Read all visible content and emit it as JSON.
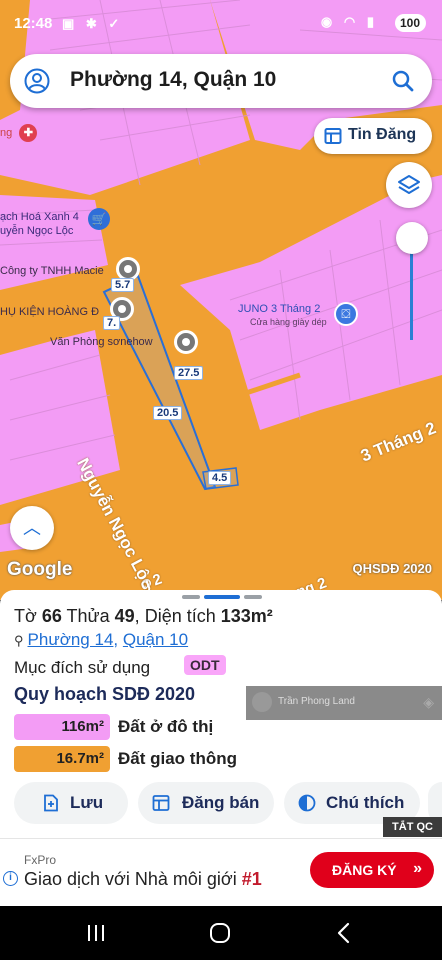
{
  "status_bar": {
    "time": "12:48",
    "left_icons": "▣ ✱ ✓",
    "right_icons": "◉ ◠ ▮",
    "battery": "100"
  },
  "search": {
    "title": "Phường 14, Quận 10",
    "icons": [
      "user-icon",
      "search-icon"
    ]
  },
  "map": {
    "tin_dang_label": "Tin Đăng",
    "google_label": "Google",
    "credit": "QHSDĐ 2020",
    "pois": [
      "ạch Hoá Xanh 4",
      "uyễn Ngọc Lộc",
      "Công ty TNHH Macie",
      "HỤ KIỆN HOÀNG Đ",
      "Văn Phòng sơnehow",
      "JUNO 3 Tháng 2",
      "Cửa hàng giày dép"
    ],
    "streets": [
      "Nguyễn Ngọc Lộc",
      "3 Tháng 2",
      "ng 2",
      "g 2"
    ],
    "dimensions": [
      "5.7",
      "7.",
      "27.5",
      "20.5",
      "4.5"
    ],
    "colors": {
      "residential": "#f39cf5",
      "traffic": "#f0a032",
      "parcel": "#2a6fd6"
    }
  },
  "parcel": {
    "to_label": "Tờ",
    "to_value": "66",
    "thua_label": "Thửa",
    "thua_value": "49",
    "area_label": "Diện tích",
    "area_value": "133m²",
    "ward": "Phường 14",
    "separator": ",",
    "district": "Quận 10",
    "purpose_label": "Mục đích sử dụng",
    "purpose_code": "ODT",
    "plan_title": "Quy hoạch SDĐ 2020",
    "watermark": "Trần Phong Land",
    "legend": [
      {
        "value": "116m²",
        "label": "Đất ở đô thị",
        "color": "#f39cf5"
      },
      {
        "value": "16.7m²",
        "label": "Đất giao thông",
        "color": "#f0a032"
      }
    ]
  },
  "actions": {
    "save": "Lưu",
    "post": "Đăng bán",
    "legend": "Chú thích"
  },
  "ad": {
    "close_label": "TẮT QC",
    "brand": "FxPro",
    "info": "i",
    "text": "Giao dịch với Nhà môi giới ",
    "highlight": "#1",
    "cta": "ĐĂNG KÝ",
    "cta_chevron": "»"
  }
}
